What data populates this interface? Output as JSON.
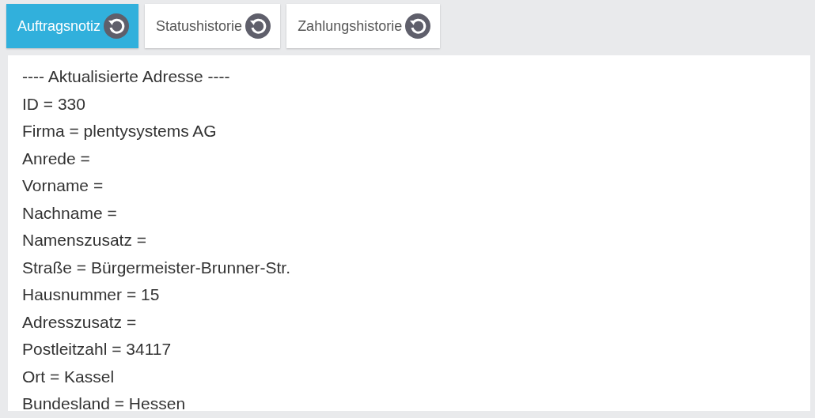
{
  "tabs": [
    {
      "label": "Auftragsnotiz",
      "selected": true
    },
    {
      "label": "Statushistorie",
      "selected": false
    },
    {
      "label": "Zahlungshistorie",
      "selected": false
    }
  ],
  "note": {
    "lines": [
      "---- Aktualisierte Adresse ----",
      "ID = 330",
      "Firma = plentysystems AG",
      "Anrede =",
      "Vorname =",
      "Nachname =",
      "Namenszusatz =",
      "Straße = Bürgermeister-Brunner-Str.",
      "Hausnummer = 15",
      "Adresszusatz =",
      "Postleitzahl = 34117",
      "Ort = Kassel",
      "Bundesland = Hessen"
    ]
  }
}
